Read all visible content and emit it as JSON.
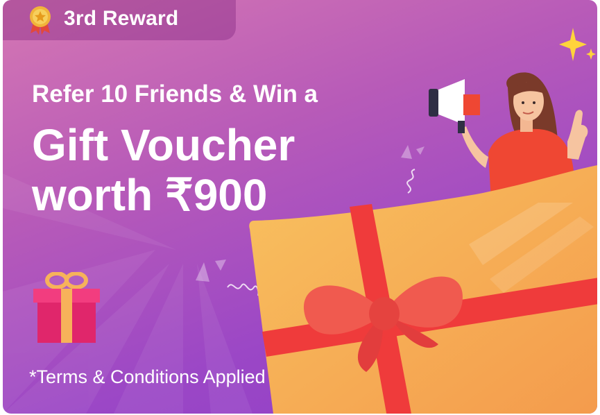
{
  "badge": {
    "label": "3rd Reward",
    "icon": "medal-icon"
  },
  "headline": {
    "line1": "Refer 10 Friends & Win a",
    "line2": "Gift Voucher",
    "line3": "worth ₹900"
  },
  "terms": "*Terms & Conditions Applied",
  "colors": {
    "bg_top": "#d577b3",
    "bg_bottom": "#8f3ec8",
    "gift_box": "#f7b25a",
    "ribbon": "#ef3b3b",
    "text": "#ffffff"
  }
}
